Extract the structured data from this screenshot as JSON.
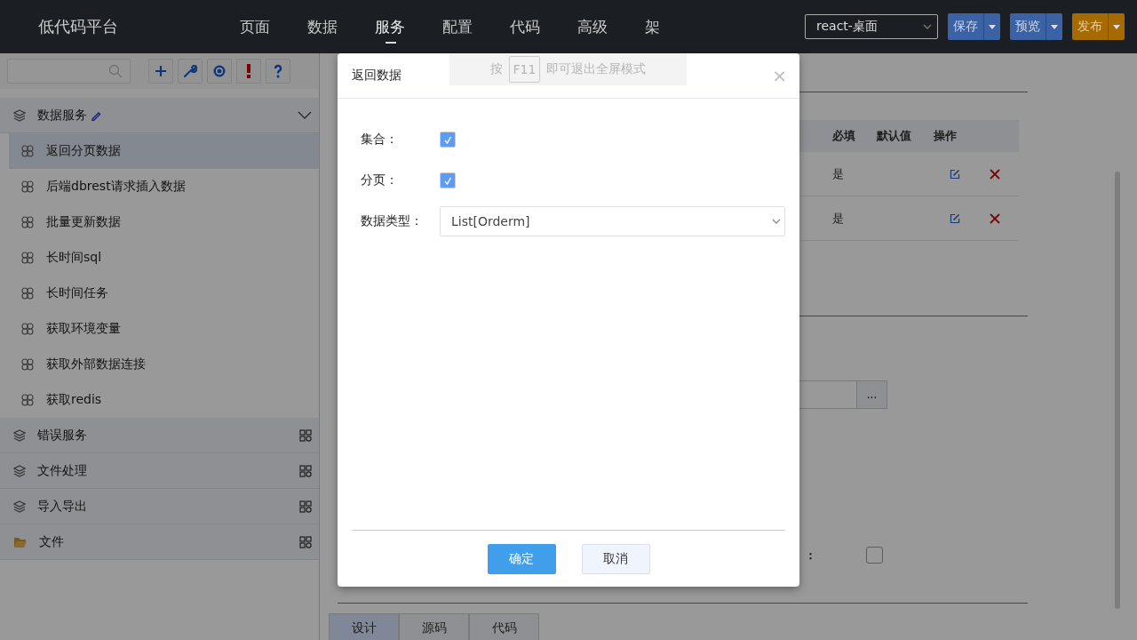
{
  "header": {
    "logo": "低代码平台",
    "nav": [
      {
        "label": "页面",
        "selected": false
      },
      {
        "label": "数据",
        "selected": false
      },
      {
        "label": "服务",
        "selected": true
      },
      {
        "label": "配置",
        "selected": false
      },
      {
        "label": "代码",
        "selected": false
      },
      {
        "label": "高级",
        "selected": false
      },
      {
        "label": "架",
        "selected": false
      }
    ],
    "app_select": {
      "value": "react-桌面"
    },
    "buttons": [
      {
        "label": "保存",
        "kind": "blue"
      },
      {
        "label": "预览",
        "kind": "blue"
      },
      {
        "label": "发布",
        "kind": "orange"
      }
    ]
  },
  "sidebar": {
    "tools": [
      {
        "kind": "add"
      },
      {
        "kind": "wrench"
      },
      {
        "kind": "target"
      },
      {
        "kind": "alert"
      },
      {
        "kind": "help"
      }
    ],
    "groups": [
      {
        "label": "数据服务",
        "kind": "layers",
        "expanded": true,
        "editable": true,
        "children": [
          {
            "label": "返回分页数据",
            "selected": true
          },
          {
            "label": "后端dbrest请求插入数据",
            "selected": false
          },
          {
            "label": "批量更新数据",
            "selected": false
          },
          {
            "label": "长时间sql",
            "selected": false
          },
          {
            "label": "长时间任务",
            "selected": false
          },
          {
            "label": "获取环境变量",
            "selected": false
          },
          {
            "label": "获取外部数据连接",
            "selected": false
          },
          {
            "label": "获取redis",
            "selected": false
          }
        ]
      },
      {
        "label": "错误服务",
        "kind": "layers",
        "expanded": false,
        "editable": false
      },
      {
        "label": "文件处理",
        "kind": "layers",
        "expanded": false,
        "editable": false
      },
      {
        "label": "导入导出",
        "kind": "layers",
        "expanded": false,
        "editable": false
      },
      {
        "label": "文件",
        "kind": "folder",
        "expanded": false,
        "editable": false
      }
    ]
  },
  "main": {
    "table": {
      "columns": [
        "必填",
        "默认值",
        "操作"
      ],
      "rows": [
        {
          "required": "是"
        },
        {
          "required": "是"
        }
      ]
    },
    "browse_button": "...",
    "checkbox_field": {
      "label": "：",
      "checked": false
    },
    "tabs": [
      {
        "label": "设计",
        "selected": true
      },
      {
        "label": "源码",
        "selected": false
      },
      {
        "label": "代码",
        "selected": false
      }
    ]
  },
  "toast": {
    "prefix": "按",
    "key": "F11",
    "suffix": "即可退出全屏模式"
  },
  "modal": {
    "title": "返回数据",
    "close": "×",
    "fields": [
      {
        "kind": "checkbox",
        "label": "集合：",
        "checked": true
      },
      {
        "kind": "checkbox",
        "label": "分页：",
        "checked": true
      },
      {
        "kind": "select",
        "label": "数据类型：",
        "value": "List[Orderm]"
      }
    ],
    "buttons": [
      {
        "label": "确定",
        "kind": "primary"
      },
      {
        "label": "取消",
        "kind": "secondary"
      }
    ]
  }
}
